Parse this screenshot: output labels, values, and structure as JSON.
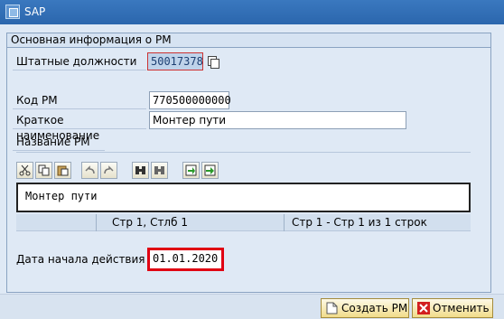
{
  "window": {
    "title": "SAP"
  },
  "group": {
    "title": "Основная информация о РМ"
  },
  "fields": {
    "shtat_label": "Штатные должности",
    "shtat_value": "50017378",
    "kod_label": "Код РМ",
    "kod_value": "770500000000",
    "short_name_label": "Краткое наименование",
    "short_name_value": "Монтер пути",
    "name_label": "Название РМ"
  },
  "editor": {
    "text": "Монтер пути",
    "status_col": "Стр 1, Стлб 1",
    "status_rows": "Стр 1 - Стр 1 из 1 строк",
    "toolbar_icons": [
      "cut-icon",
      "copy-icon",
      "paste-icon",
      "undo-icon",
      "redo-icon",
      "find-icon",
      "find-next-icon",
      "import-icon",
      "export-icon"
    ]
  },
  "date": {
    "label": "Дата начала действия",
    "value": "01.01.2020",
    "highlight_color": "#e00012"
  },
  "buttons": {
    "create_label": "Создать РМ",
    "cancel_label": "Отменить"
  }
}
